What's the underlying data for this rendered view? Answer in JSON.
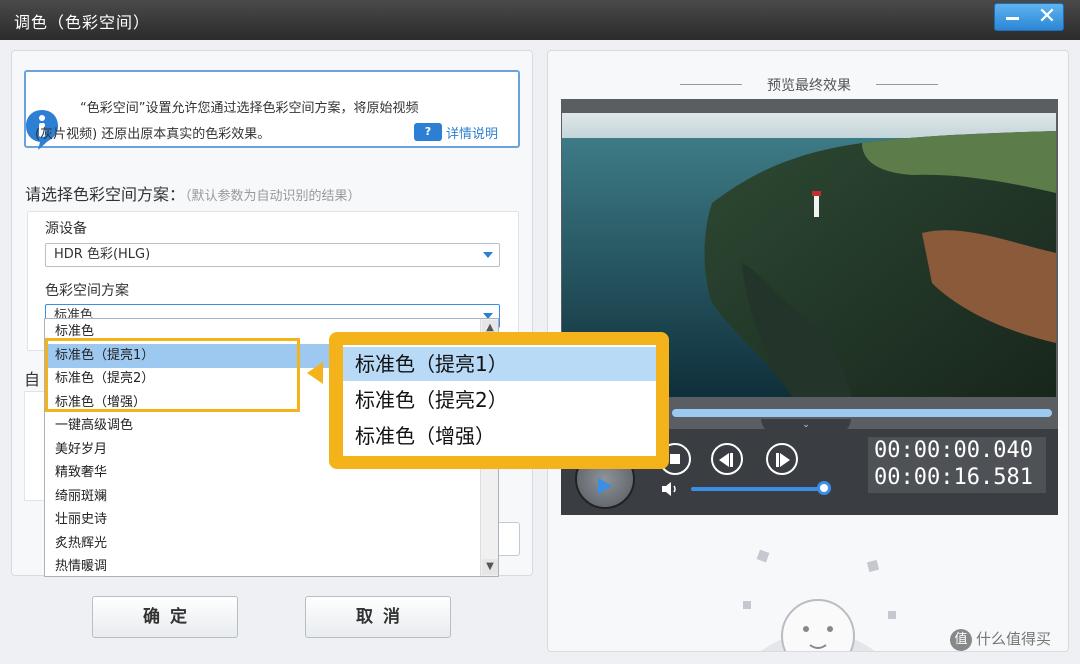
{
  "window": {
    "title": "调色（色彩空间）"
  },
  "info": {
    "line1": "“色彩空间”设置允许您通过选择色彩空间方案，将原始视频",
    "line2": "(灰片视频) 还原出原本真实的色彩效果。",
    "help_icon_text": "?",
    "help_link": "详情说明"
  },
  "scheme": {
    "label": "请选择色彩空间方案：",
    "hint": "（默认参数为自动识别的结果）",
    "source_label": "源设备",
    "source_value": "HDR 色彩(HLG)",
    "scheme_label": "色彩空间方案",
    "scheme_value": "标准色"
  },
  "behind": {
    "label": "自"
  },
  "dropdown": {
    "items": [
      "标准色",
      "标准色（提亮1）",
      "标准色（提亮2）",
      "标准色（增强）",
      "一键高级调色",
      "美好岁月",
      "精致奢华",
      "绮丽斑斓",
      "壮丽史诗",
      "炙热辉光",
      "热情暖调"
    ],
    "selected_index": 1
  },
  "callout": {
    "items": [
      "标准色（提亮1）",
      "标准色（提亮2）",
      "标准色（增强）"
    ],
    "selected_index": 0
  },
  "buttons": {
    "ok": "确定",
    "cancel": "取消"
  },
  "preview": {
    "title": "预览最终效果",
    "time_current": "00:00:00.040",
    "time_total": "00:00:16.581",
    "volume_level": 0.95
  },
  "watermark": {
    "badge": "值",
    "text": "什么值得买"
  },
  "colors": {
    "accent": "#2c7fd3",
    "highlight": "#f5b31b",
    "selection": "#9dc9f1"
  }
}
